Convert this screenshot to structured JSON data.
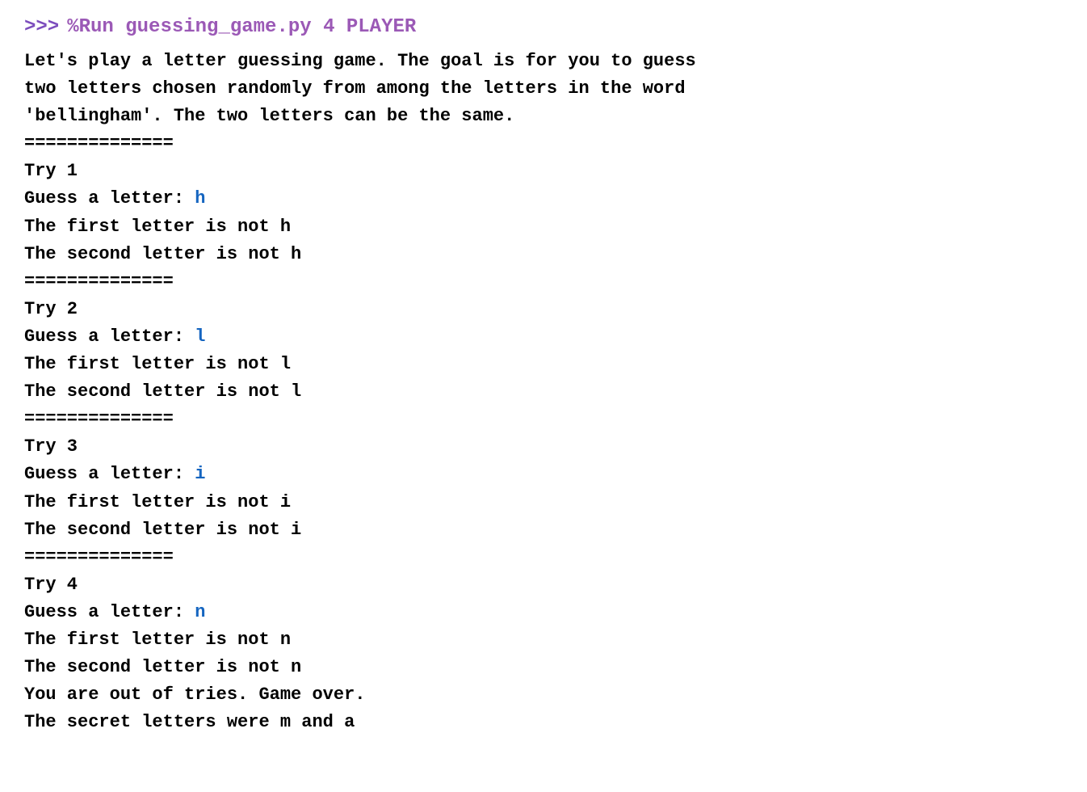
{
  "terminal": {
    "prompt_arrow": ">>>",
    "prompt_command": "%Run guessing_game.py 4 PLAYER",
    "lines": [
      {
        "id": "intro1",
        "text": "Let's play a letter guessing game. The goal is for you to guess",
        "type": "normal"
      },
      {
        "id": "intro2",
        "text": "two letters chosen randomly from among the letters in the word",
        "type": "normal"
      },
      {
        "id": "intro3",
        "text": "'bellingham'. The two letters can be the same.",
        "type": "normal"
      },
      {
        "id": "sep1",
        "text": "==============",
        "type": "separator"
      },
      {
        "id": "try1",
        "text": "Try 1",
        "type": "normal"
      },
      {
        "id": "guess1",
        "text": "Guess a letter: ",
        "type": "normal",
        "input": "h"
      },
      {
        "id": "result1a",
        "text": "The first letter is not h",
        "type": "normal"
      },
      {
        "id": "result1b",
        "text": "The second letter is not h",
        "type": "normal"
      },
      {
        "id": "sep2",
        "text": "==============",
        "type": "separator"
      },
      {
        "id": "try2",
        "text": "Try 2",
        "type": "normal"
      },
      {
        "id": "guess2",
        "text": "Guess a letter: ",
        "type": "normal",
        "input": "l"
      },
      {
        "id": "result2a",
        "text": "The first letter is not l",
        "type": "normal"
      },
      {
        "id": "result2b",
        "text": "The second letter is not l",
        "type": "normal"
      },
      {
        "id": "sep3",
        "text": "==============",
        "type": "separator"
      },
      {
        "id": "try3",
        "text": "Try 3",
        "type": "normal"
      },
      {
        "id": "guess3",
        "text": "Guess a letter: ",
        "type": "normal",
        "input": "i"
      },
      {
        "id": "result3a",
        "text": "The first letter is not i",
        "type": "normal"
      },
      {
        "id": "result3b",
        "text": "The second letter is not i",
        "type": "normal"
      },
      {
        "id": "sep4",
        "text": "==============",
        "type": "separator"
      },
      {
        "id": "try4",
        "text": "Try 4",
        "type": "normal"
      },
      {
        "id": "guess4",
        "text": "Guess a letter: ",
        "type": "normal",
        "input": "n"
      },
      {
        "id": "result4a",
        "text": "The first letter is not n",
        "type": "normal"
      },
      {
        "id": "result4b",
        "text": "The second letter is not n",
        "type": "normal"
      },
      {
        "id": "gameover",
        "text": "You are out of tries. Game over.",
        "type": "normal"
      },
      {
        "id": "secret",
        "text": "The secret letters were m and a",
        "type": "normal"
      }
    ]
  }
}
